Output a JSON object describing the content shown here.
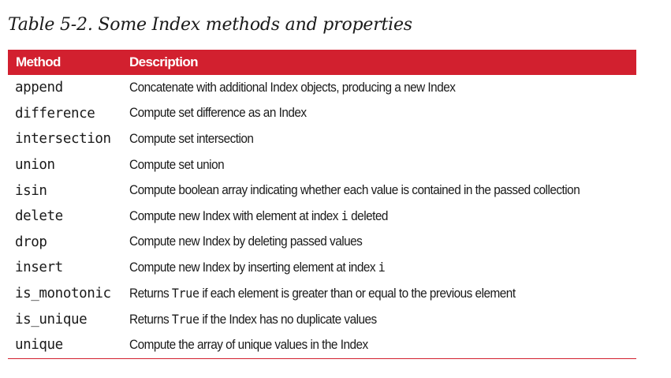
{
  "caption": "Table 5-2. Some Index methods and properties",
  "table": {
    "headers": {
      "method": "Method",
      "description": "Description"
    },
    "rows": [
      {
        "method": "append",
        "parts": [
          {
            "t": "Concatenate with additional Index objects, producing a new Index",
            "code": false
          }
        ]
      },
      {
        "method": "difference",
        "parts": [
          {
            "t": "Compute set difference as an Index",
            "code": false
          }
        ]
      },
      {
        "method": "intersection",
        "parts": [
          {
            "t": "Compute set intersection",
            "code": false
          }
        ]
      },
      {
        "method": "union",
        "parts": [
          {
            "t": "Compute set union",
            "code": false
          }
        ]
      },
      {
        "method": "isin",
        "parts": [
          {
            "t": "Compute boolean array indicating whether each value is contained in the passed collection",
            "code": false
          }
        ]
      },
      {
        "method": "delete",
        "parts": [
          {
            "t": "Compute new Index with element at index ",
            "code": false
          },
          {
            "t": "i",
            "code": true
          },
          {
            "t": " deleted",
            "code": false
          }
        ]
      },
      {
        "method": "drop",
        "parts": [
          {
            "t": "Compute new Index by deleting passed values",
            "code": false
          }
        ]
      },
      {
        "method": "insert",
        "parts": [
          {
            "t": "Compute new Index by inserting element at index ",
            "code": false
          },
          {
            "t": "i",
            "code": true
          }
        ]
      },
      {
        "method": "is_monotonic",
        "parts": [
          {
            "t": "Returns ",
            "code": false
          },
          {
            "t": "True",
            "code": true
          },
          {
            "t": " if each element is greater than or equal to the previous element",
            "code": false
          }
        ]
      },
      {
        "method": "is_unique",
        "parts": [
          {
            "t": "Returns ",
            "code": false
          },
          {
            "t": "True",
            "code": true
          },
          {
            "t": " if the Index has no duplicate values",
            "code": false
          }
        ]
      },
      {
        "method": "unique",
        "parts": [
          {
            "t": "Compute the array of unique values in the Index",
            "code": false
          }
        ]
      }
    ]
  },
  "colors": {
    "header_background": "#d2202f",
    "header_text": "#ffffff",
    "body_text": "#1a1a1a",
    "rule": "#d2202f"
  }
}
